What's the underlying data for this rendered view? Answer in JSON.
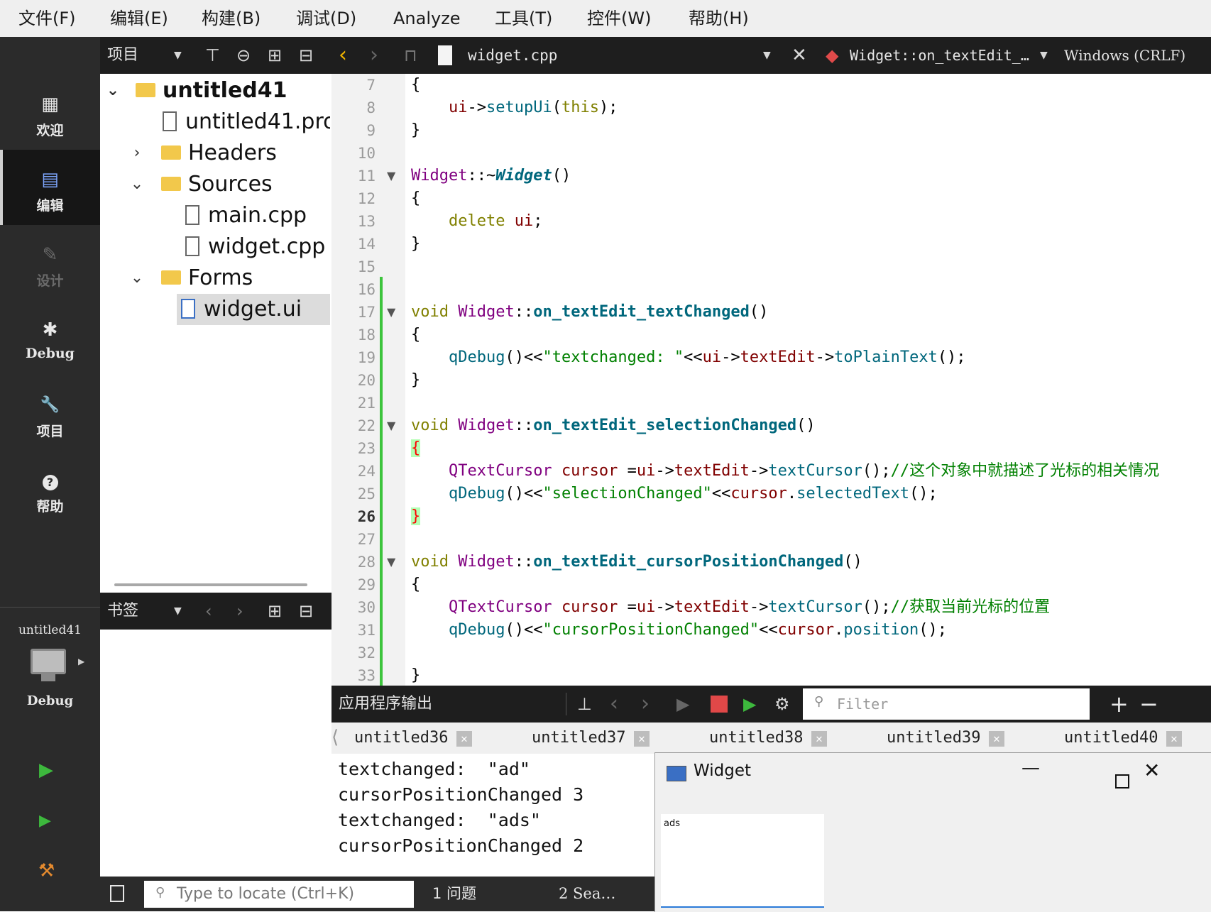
{
  "menu": [
    "文件(F)",
    "编辑(E)",
    "构建(B)",
    "调试(D)",
    "Analyze",
    "工具(T)",
    "控件(W)",
    "帮助(H)"
  ],
  "modes": [
    {
      "label": "欢迎",
      "icon": "grid-icon",
      "glyph": "▦"
    },
    {
      "label": "编辑",
      "icon": "edit-doc-icon",
      "glyph": "▤"
    },
    {
      "label": "设计",
      "icon": "pencil-icon",
      "glyph": "✎"
    },
    {
      "label": "Debug",
      "icon": "bug-icon",
      "glyph": "✱"
    },
    {
      "label": "项目",
      "icon": "wrench-icon",
      "glyph": "🔧"
    },
    {
      "label": "帮助",
      "icon": "help-icon",
      "glyph": "?"
    }
  ],
  "kit": {
    "project": "untitled41",
    "config": "Debug"
  },
  "projects_pane": {
    "title": "项目"
  },
  "bookmarks_pane": {
    "title": "书签"
  },
  "tree": {
    "root": "untitled41",
    "pro_file": "untitled41.pro",
    "headers": "Headers",
    "sources": "Sources",
    "main_cpp": "main.cpp",
    "widget_cpp": "widget.cpp",
    "forms": "Forms",
    "widget_ui": "widget.ui"
  },
  "editor": {
    "file": "widget.cpp",
    "symbol": "Widget::on_textEdit_…",
    "line_ending": "Windows (CRLF)",
    "current_line": 26,
    "line_numbers": [
      "7",
      "8",
      "9",
      "10",
      "11",
      "12",
      "13",
      "14",
      "15",
      "16",
      "17",
      "18",
      "19",
      "20",
      "21",
      "22",
      "23",
      "24",
      "25",
      "26",
      "27",
      "28",
      "29",
      "30",
      "31",
      "32",
      "33"
    ]
  },
  "output": {
    "title": "应用程序输出",
    "filter_placeholder": "Filter",
    "tabs": [
      "untitled36",
      "untitled37",
      "untitled38",
      "untitled39",
      "untitled40"
    ],
    "lines": [
      "textchanged:  \"ad\"",
      "cursorPositionChanged 3",
      "textchanged:  \"ads\"",
      "cursorPositionChanged 2"
    ]
  },
  "status": {
    "locate_placeholder": "Type to locate (Ctrl+K)",
    "issues": "1  问题",
    "search": "2  Sea…"
  },
  "widget_window": {
    "title": "Widget",
    "text": "ads"
  }
}
